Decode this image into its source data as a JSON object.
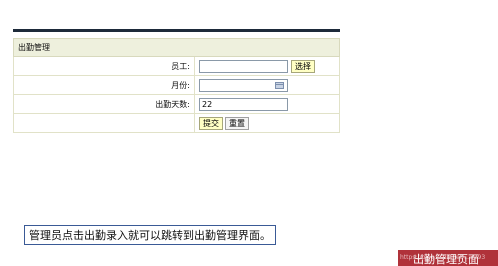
{
  "panel": {
    "title": "出勤管理",
    "fields": {
      "employee": {
        "label": "员工:",
        "value": "",
        "select_button": "选择"
      },
      "month": {
        "label": "月份:",
        "value": ""
      },
      "days": {
        "label": "出勤天数:",
        "value": "22"
      }
    },
    "buttons": {
      "submit": "提交",
      "reset": "重置"
    }
  },
  "caption": "管理员点击出勤录入就可以跳转到出勤管理界面。",
  "watermark": {
    "url": "https://blog.csdn.net/...3293",
    "title": "出勤管理页面"
  },
  "colors": {
    "topbar": "#1d2a3a",
    "title_row_bg": "#eef0dd",
    "caption_border": "#3a5a96",
    "watermark_bg": "#b0323a"
  }
}
